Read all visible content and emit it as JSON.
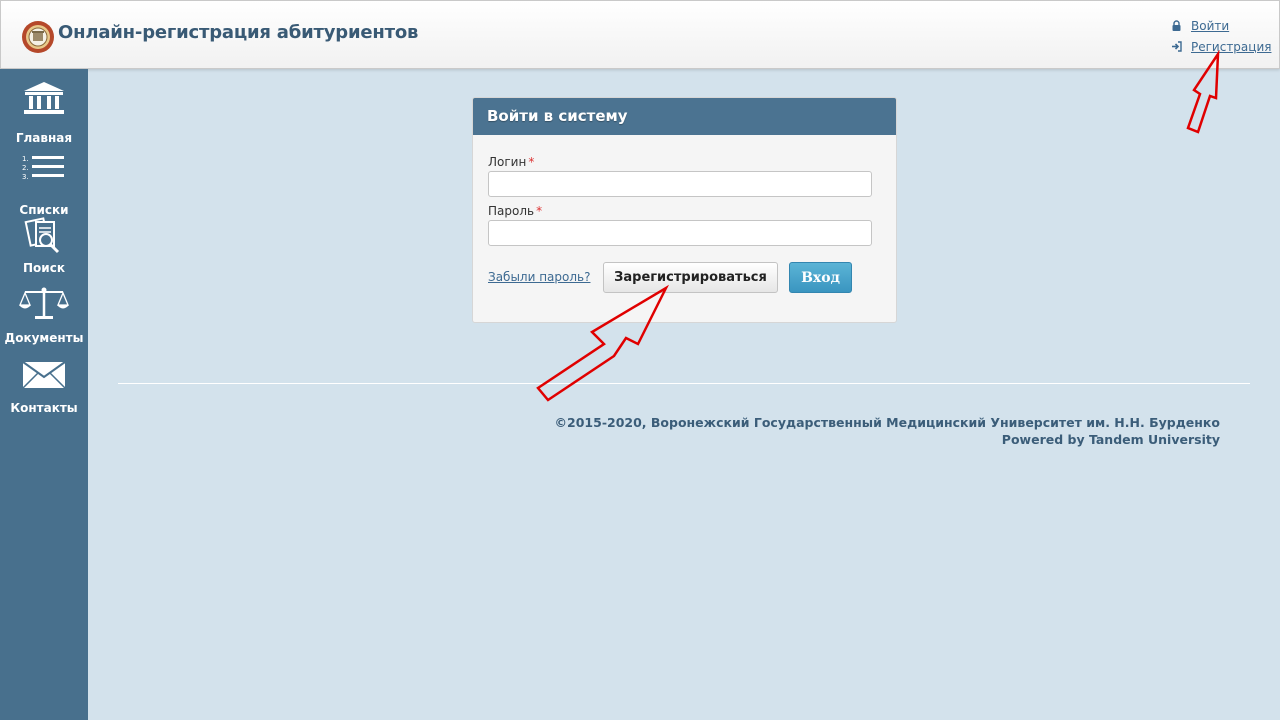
{
  "header": {
    "title": "Онлайн-регистрация абитуриентов",
    "links": [
      {
        "label": "Войти",
        "icon": "lock-icon"
      },
      {
        "label": "Регистрация",
        "icon": "sign-in-icon"
      }
    ]
  },
  "sidebar": {
    "items": [
      {
        "label": "Главная",
        "icon": "building-icon"
      },
      {
        "label": "Списки",
        "icon": "list-icon"
      },
      {
        "label": "Поиск",
        "icon": "search-documents-icon"
      },
      {
        "label": "Документы",
        "icon": "scales-icon"
      },
      {
        "label": "Контакты",
        "icon": "envelope-icon"
      }
    ]
  },
  "login": {
    "title": "Войти в систему",
    "login_label": "Логин",
    "password_label": "Пароль",
    "required_mark": "*",
    "login_value": "",
    "password_value": "",
    "forgot_label": "Забыли пароль?",
    "register_button": "Зарегистрироваться",
    "submit_button": "Вход"
  },
  "footer": {
    "copyright": "©2015-2020, Воронежский Государственный Медицинский Университет им. Н.Н. Бурденко",
    "powered": "Powered by Tandem University"
  },
  "colors": {
    "sidebar_bg": "#48708d",
    "page_bg": "#d3e2ec",
    "panel_header": "#4b7391",
    "accent_button": "#3a95c0",
    "annotation_arrow": "#e00000"
  }
}
